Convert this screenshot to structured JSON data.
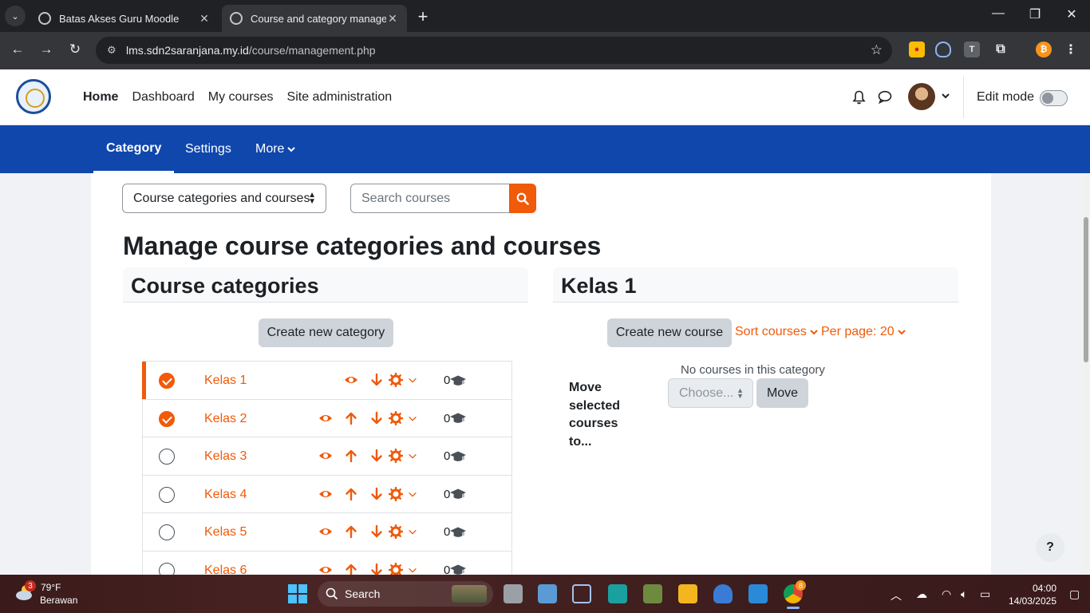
{
  "browser": {
    "tabs": [
      {
        "title": "Batas Akses Guru Moodle",
        "active": false
      },
      {
        "title": "Course and category management",
        "active": true
      }
    ],
    "url_host": "lms.sdn2saranjana.my.id",
    "url_path": "/course/management.php"
  },
  "header": {
    "nav": [
      "Home",
      "Dashboard",
      "My courses",
      "Site administration"
    ],
    "edit_mode_label": "Edit mode"
  },
  "secondary_nav": {
    "items": [
      "Category",
      "Settings",
      "More"
    ]
  },
  "controls": {
    "view_select": "Course categories and courses",
    "search_placeholder": "Search courses"
  },
  "page_title": "Manage course categories and courses",
  "categories_panel": {
    "title": "Course categories",
    "create_label": "Create new category",
    "rows": [
      {
        "name": "Kelas 1",
        "checked": true,
        "count": "0",
        "highlight": true,
        "has_up": false
      },
      {
        "name": "Kelas 2",
        "checked": true,
        "count": "0",
        "highlight": false,
        "has_up": true
      },
      {
        "name": "Kelas 3",
        "checked": false,
        "count": "0",
        "highlight": false,
        "has_up": true
      },
      {
        "name": "Kelas 4",
        "checked": false,
        "count": "0",
        "highlight": false,
        "has_up": true
      },
      {
        "name": "Kelas 5",
        "checked": false,
        "count": "0",
        "highlight": false,
        "has_up": true
      },
      {
        "name": "Kelas 6",
        "checked": false,
        "count": "0",
        "highlight": false,
        "has_up": true
      }
    ]
  },
  "courses_panel": {
    "title": "Kelas 1",
    "create_label": "Create new course",
    "sort_label": "Sort courses",
    "perpage_label": "Per page: 20",
    "empty_text": "No courses in this category",
    "move_label": "Move selected courses to...",
    "choose_placeholder": "Choose...",
    "move_button": "Move"
  },
  "help_label": "?",
  "taskbar": {
    "weather_badge": "3",
    "temperature": "79°F",
    "condition": "Berawan",
    "search_label": "Search",
    "time": "04:00",
    "date": "14/03/2025",
    "chrome_badge": "8"
  },
  "colors": {
    "brand": "#f05a09",
    "secondary_nav": "#0f47ad"
  }
}
